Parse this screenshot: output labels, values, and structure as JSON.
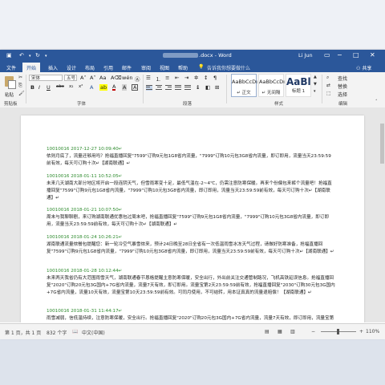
{
  "titlebar": {
    "doc_suffix": ".docx",
    "separator": " - ",
    "app": "Word",
    "user": "Li Jun",
    "undo_icon": "undo-icon",
    "redo_icon": "redo-icon",
    "save_icon": "save-icon"
  },
  "tabs": [
    "文件",
    "开始",
    "插入",
    "设计",
    "布局",
    "引用",
    "邮件",
    "审阅",
    "视图",
    "帮助"
  ],
  "active_tab": "开始",
  "tell_me": "告诉我你想要做什么",
  "share": "共享",
  "ribbon": {
    "paste": "粘贴",
    "font_name": "宋体",
    "font_size": "五号",
    "bold": "B",
    "italic": "I",
    "underline": "U",
    "strike": "abc",
    "subscript": "x₂",
    "superscript": "x²",
    "font_color_a": "A",
    "groups": {
      "clipboard": "剪贴板",
      "font": "字体",
      "paragraph": "段落",
      "styles": "样式",
      "editing": "编辑"
    },
    "styles": [
      {
        "sample": "AaBbCcDı",
        "name": "↵ 正文"
      },
      {
        "sample": "AaBbCcDı",
        "name": "↵ 无间隔"
      },
      {
        "sample": "AaBl",
        "name": "标题 1"
      }
    ],
    "find": "查找",
    "replace": "替换",
    "select": "选择"
  },
  "entries": [
    {
      "header": "10010016 2017-12-27 10:09:40↵",
      "body": "侬则月底了，流量还够用吗？抢福直播回复\"7599\"订购9元包1G8省内流量，\"7999\"订购10元包3G8省内流量，即订即用，流量当天23:59:59前有效，每天可订购十次↵【湖南联通】↵"
    },
    {
      "header": "10010016 2018-01-11 10:52:05↵",
      "body": "未来几天湖南大部分地区将开启一段连阴天气，但雪雨寒变十足，最低气温在-2~4℃，仍需注意防寒保暖。再来个份偏包来裤个流量吧！抢福直播回复\"7599\"订购9元包1G8省内流量，\"7999\"订购10元包3G8省内流量，即订即用，流量当天23:59:59前有效，每天可订购十次↵【湖南联通】↵"
    },
    {
      "header": "10010016 2018-01-21 10:07:50↵",
      "body": "周末与我聊聊剧，来订购湖南联通优惠包过周末吧，抢福直播回复\"7599\"订购9元包1G8省内流量，\"7999\"订购10元包3G8省内流量，即订即用，流量当天23:59:59前有效，每天可订购十次↵【湖南联通】↵"
    },
    {
      "header": "10010016 2018-01-24 10:26:21↵",
      "body": "湖南联通流量侬餐包提醒您：新一轮冷空气暴雪侬来，预计24日晚至28日全省有一次低温雨雪冰冻天气过程，请做好防寒准备，抢福直播回复\"7599\"订购9元包1G8省内流量，\"7999\"订购10元包3G8省内流量，即订即用，流量当天23:59:59前有效，每天可订购十次↵【湖南联通】↵"
    },
    {
      "header": "10010016 2018-01-28 10:12:44↵",
      "body": "未来两天我省仍有大范围雨雪天气，湖南联通春节恩格提醒主意防寒保暖，安全出行，外出前关注交通管制路况，飞机高铁延误信息。抢福直播回复\"2020\"订购20元包3G国内+7G省内流量，流量7天有效，即订即用。流量宝第2天23:59:59前有效，抢福直播回复\"2030\"订购30元包3G国内+7G省内流量，流量10天有效，流量宝第10天23:59:59前有效。可同月使用，不可结转，用本证真真的流量退赔偿！【湖南联通】↵"
    },
    {
      "header": "10010016 2018-01-31 11:44:17↵",
      "body": "雨雪减弱，信低温持续，注意防寒保暖，安全出行。抢福直播回复\"2020\"订购20元包3G国内+7G省内流量，流量7天有效，即订即用，流量宝第7天23:59:59前有效，抢福直播回复\"2030\"订购30元包3G国内+10G省内流量，"
    }
  ],
  "status": {
    "page": "第 1 页，共 1 页",
    "words": "832 个字",
    "lang": "中文(中国)",
    "zoom_minus": "−",
    "zoom_plus": "+",
    "zoom": "110%"
  }
}
